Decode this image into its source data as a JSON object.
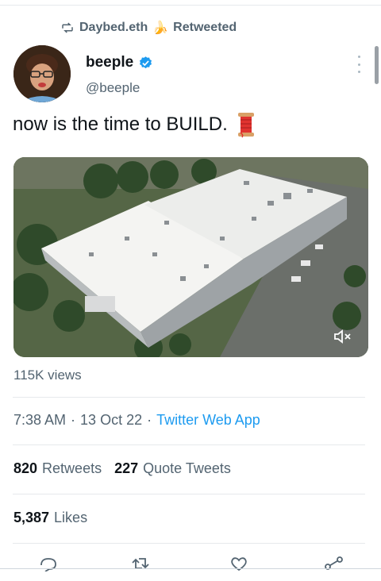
{
  "retweet_bar": {
    "retweeter": "Daybed.eth",
    "emoji": "🍌",
    "action": "Retweeted"
  },
  "author": {
    "display_name": "beeple",
    "handle": "@beeple",
    "verified": true
  },
  "tweet": {
    "text": "now is the time to BUILD.",
    "emoji_icon": "spool-of-thread-icon"
  },
  "media": {
    "type": "video",
    "description_icon": "muted-speaker-icon"
  },
  "stats": {
    "views": "115K views",
    "time": "7:38 AM",
    "separator": "·",
    "date": "13 Oct 22",
    "app": "Twitter Web App",
    "retweets_count": "820",
    "retweets_label": "Retweets",
    "quotes_count": "227",
    "quotes_label": "Quote Tweets",
    "likes_count": "5,387",
    "likes_label": "Likes"
  },
  "actions": [
    "reply-icon",
    "retweet-icon",
    "like-icon",
    "share-icon"
  ],
  "colors": {
    "link": "#1d9bf0",
    "muted": "#536471",
    "text": "#0f1419",
    "verified": "#1d9bf0"
  }
}
